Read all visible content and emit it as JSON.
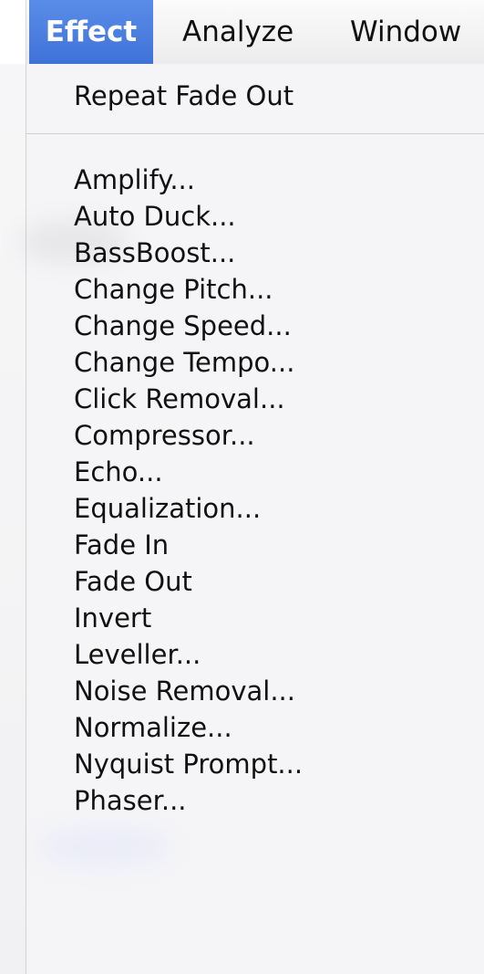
{
  "menubar": {
    "items": [
      {
        "label": "Effect"
      },
      {
        "label": "Analyze"
      },
      {
        "label": "Window"
      }
    ]
  },
  "effect_menu": {
    "top_item": "Repeat Fade Out",
    "items": [
      "Amplify...",
      "Auto Duck...",
      "BassBoost...",
      "Change Pitch...",
      "Change Speed...",
      "Change Tempo...",
      "Click Removal...",
      "Compressor...",
      "Echo...",
      "Equalization...",
      "Fade In",
      "Fade Out",
      "Invert",
      "Leveller...",
      "Noise Removal...",
      "Normalize...",
      "Nyquist Prompt...",
      "Phaser..."
    ]
  },
  "colors": {
    "selected_menu_blue": "#3f72d7",
    "menu_background": "#f4f4f6",
    "text": "#111111"
  }
}
